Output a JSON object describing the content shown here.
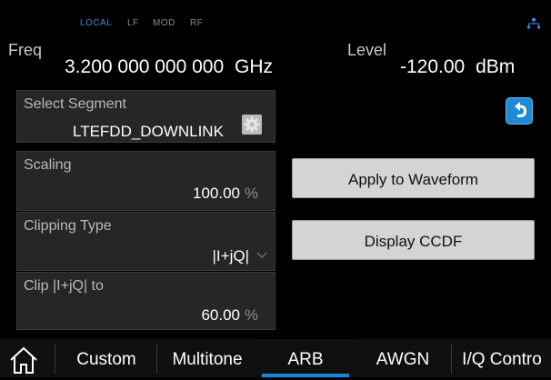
{
  "header": {
    "indicators": [
      "LOCAL",
      "LF",
      "MOD",
      "RF"
    ],
    "active_indicator": "LOCAL",
    "freq_label": "Freq",
    "freq_value": "3.200 000 000 000",
    "freq_unit": "GHz",
    "level_label": "Level",
    "level_value": "-120.00",
    "level_unit": "dBm",
    "network_icon": "network-icon"
  },
  "segment": {
    "label": "Select Segment",
    "value": "LTEFDD_DOWNLINK",
    "icon": "gear-icon"
  },
  "scaling": {
    "label": "Scaling",
    "value": "100.00",
    "unit": "%"
  },
  "clipping_type": {
    "label": "Clipping Type",
    "value": "|I+jQ|"
  },
  "clip_to": {
    "label": "Clip |I+jQ| to",
    "value": "60.00",
    "unit": "%"
  },
  "buttons": {
    "apply": "Apply to Waveform",
    "display_ccdf": "Display CCDF",
    "back_icon": "back-arrow-icon"
  },
  "tabs": [
    {
      "label": "Custom"
    },
    {
      "label": "Multitone"
    },
    {
      "label": "ARB"
    },
    {
      "label": "AWGN"
    },
    {
      "label": "I/Q Contro"
    }
  ],
  "active_tab": "ARB",
  "colors": {
    "accent": "#1f86d6",
    "active_indicator": "#3d86e6"
  }
}
